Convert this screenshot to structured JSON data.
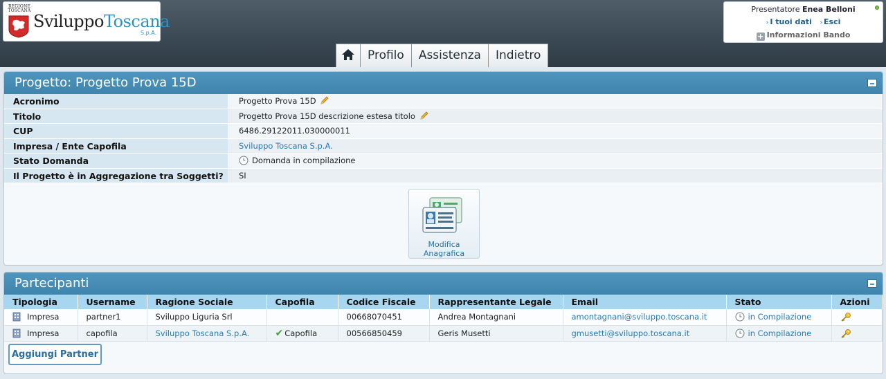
{
  "header": {
    "logo": {
      "region": "REGIONE TOSCANA",
      "word1": "Sviluppo",
      "word2": "Toscana",
      "suffix": "S.p.A."
    },
    "user": {
      "role_label": "Presentatore",
      "name": "Enea Belloni",
      "my_data_link": "I tuoi dati",
      "logout_link": "Esci",
      "info_link": "Informazioni Bando"
    },
    "nav": [
      {
        "label": "",
        "icon": "home-icon"
      },
      {
        "label": "Profilo"
      },
      {
        "label": "Assistenza"
      },
      {
        "label": "Indietro"
      }
    ]
  },
  "project": {
    "title": "Progetto: Progetto Prova 15D",
    "rows": [
      {
        "label": "Acronimo",
        "value": "Progetto Prova 15D"
      },
      {
        "label": "Titolo",
        "value": "Progetto Prova 15D descrizione estesa titolo"
      },
      {
        "label": "CUP",
        "value": "6486.29122011.030000011"
      },
      {
        "label": "Impresa / Ente Capofila",
        "value": "Sviluppo Toscana S.p.A."
      },
      {
        "label": "Stato Domanda",
        "value": "Domanda in compilazione"
      },
      {
        "label": "Il Progetto è in Aggregazione tra Soggetti?",
        "value": "SI"
      }
    ],
    "edit_button_label": "Modifica Anagrafica"
  },
  "participants": {
    "title": "Partecipanti",
    "columns": [
      "Tipologia",
      "Username",
      "Ragione Sociale",
      "Capofila",
      "Codice Fiscale",
      "Rappresentante Legale",
      "Email",
      "Stato",
      "Azioni"
    ],
    "rows": [
      {
        "tipologia": "Impresa",
        "username": "partner1",
        "ragione_sociale": "Sviluppo Liguria Srl",
        "capofila": "",
        "codice_fiscale": "00668070451",
        "rappresentante": "Andrea Montagnani",
        "email": "amontagnani@sviluppo.toscana.it",
        "stato": "in Compilazione"
      },
      {
        "tipologia": "Impresa",
        "username": "capofila",
        "ragione_sociale": "Sviluppo Toscana S.p.A.",
        "capofila": "Capofila",
        "codice_fiscale": "00566850459",
        "rappresentante": "Geris Musetti",
        "email": "gmusetti@sviluppo.toscana.it",
        "stato": "in Compilazione"
      }
    ],
    "add_button_label": "Aggiungi Partner"
  },
  "colors": {
    "panel_header": "#4389b2",
    "table_header": "#a6d6f0",
    "link": "#2a7ab0",
    "label_bg": "#d7e7f2"
  }
}
